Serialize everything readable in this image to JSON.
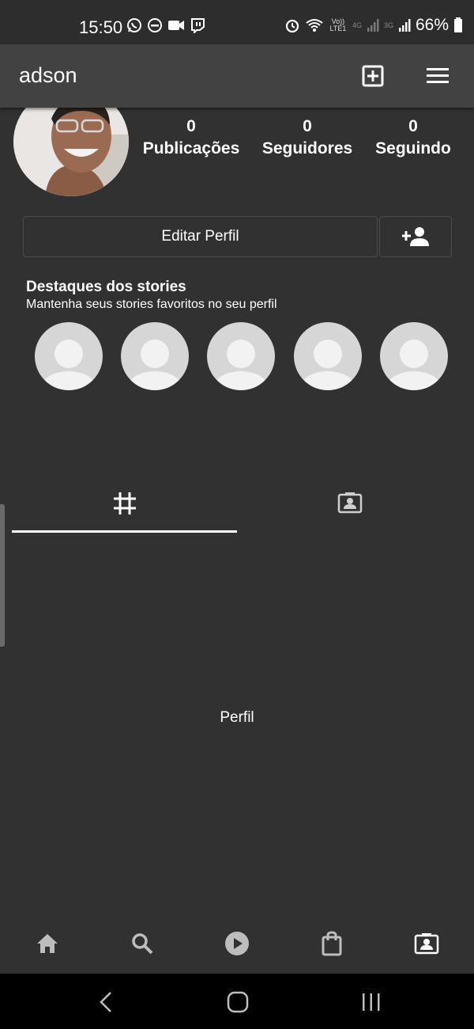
{
  "status_bar": {
    "time": "15:50",
    "volte_label": "Vo)) LTE1",
    "net1_label": "4G",
    "net2_label": "3G",
    "battery": "66%"
  },
  "app_bar": {
    "username": "adson"
  },
  "profile": {
    "stats": [
      {
        "value": "0",
        "label": "Publicações"
      },
      {
        "value": "0",
        "label": "Seguidores"
      },
      {
        "value": "0",
        "label": "Seguindo"
      }
    ],
    "edit_button": "Editar Perfil"
  },
  "highlights": {
    "title": "Destaques dos stories",
    "subtitle": "Mantenha seus stories favoritos no seu perfil"
  },
  "content": {
    "text": "Perfil"
  },
  "colors": {
    "background": "#313131",
    "app_bar": "#424242",
    "text": "#ffffff",
    "placeholder": "#d6d6d6"
  },
  "icons": {
    "app_bar": [
      "add-box-icon",
      "menu-icon"
    ],
    "tabs": [
      "grid-icon",
      "portrait-icon"
    ],
    "bottom_nav": [
      "home-icon",
      "search-icon",
      "play-icon",
      "shopping-bag-icon",
      "portrait-icon"
    ],
    "system_nav": [
      "back-icon",
      "home-icon",
      "recents-icon"
    ]
  }
}
